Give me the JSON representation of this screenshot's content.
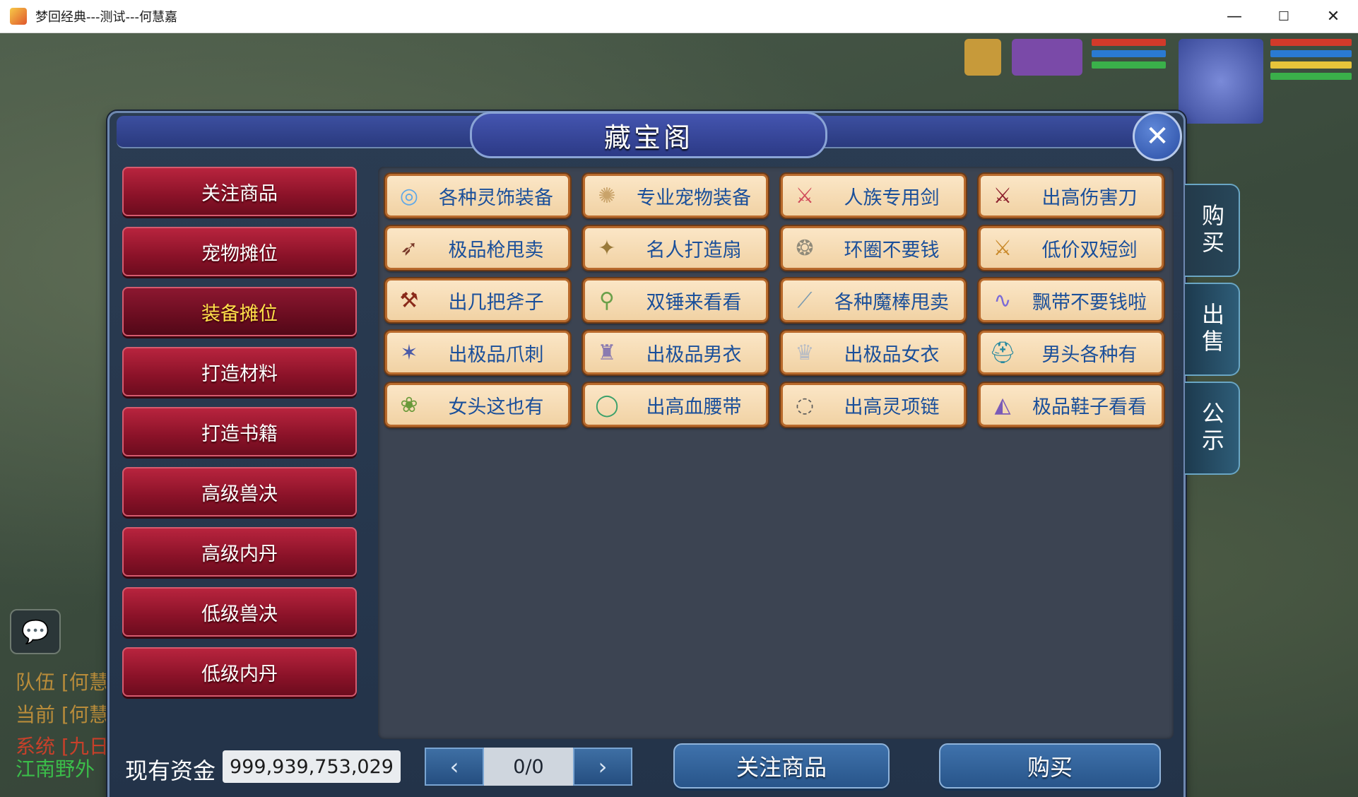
{
  "window": {
    "title": "梦回经典---测试---何慧嘉",
    "minimize_icon": "minimize-icon",
    "maximize_icon": "maximize-icon",
    "close_icon": "close-icon"
  },
  "game_hud": {
    "chat_lines": [
      "队伍 [何慧",
      "当前 [何慧",
      "系统 [九日"
    ],
    "location_text": "江南野外"
  },
  "dialog": {
    "title": "藏宝阁",
    "close_glyph": "✕"
  },
  "categories": [
    {
      "label": "关注商品",
      "active": false
    },
    {
      "label": "宠物摊位",
      "active": false
    },
    {
      "label": "装备摊位",
      "active": true
    },
    {
      "label": "打造材料",
      "active": false
    },
    {
      "label": "打造书籍",
      "active": false
    },
    {
      "label": "高级兽决",
      "active": false
    },
    {
      "label": "高级内丹",
      "active": false
    },
    {
      "label": "低级兽决",
      "active": false
    },
    {
      "label": "低级内丹",
      "active": false
    }
  ],
  "items": [
    {
      "label": "各种灵饰装备",
      "icon": "ring-icon",
      "glyph": "◎",
      "color": "#5fa8e8"
    },
    {
      "label": "专业宠物装备",
      "icon": "pet-collar-icon",
      "glyph": "✺",
      "color": "#c9a36a"
    },
    {
      "label": "人族专用剑",
      "icon": "sword-icon",
      "glyph": "⚔",
      "color": "#d04a5a"
    },
    {
      "label": "出高伤害刀",
      "icon": "blade-icon",
      "glyph": "⚔",
      "color": "#8a1c2a"
    },
    {
      "label": "极品枪甩卖",
      "icon": "spear-icon",
      "glyph": "➶",
      "color": "#7a3a2a"
    },
    {
      "label": "名人打造扇",
      "icon": "fan-icon",
      "glyph": "✦",
      "color": "#9a7a3a"
    },
    {
      "label": "环圈不要钱",
      "icon": "hoop-icon",
      "glyph": "❂",
      "color": "#8f8a7a"
    },
    {
      "label": "低价双短剑",
      "icon": "twin-dagger-icon",
      "glyph": "⚔",
      "color": "#c9892a"
    },
    {
      "label": "出几把斧子",
      "icon": "axe-icon",
      "glyph": "⚒",
      "color": "#8a2a1a"
    },
    {
      "label": "双锤来看看",
      "icon": "hammer-icon",
      "glyph": "⚲",
      "color": "#6aa04a"
    },
    {
      "label": "各种魔棒甩卖",
      "icon": "wand-icon",
      "glyph": "⟋",
      "color": "#7a9ab0"
    },
    {
      "label": "飘带不要钱啦",
      "icon": "ribbon-icon",
      "glyph": "∿",
      "color": "#7a6ad8"
    },
    {
      "label": "出极品爪刺",
      "icon": "claw-icon",
      "glyph": "✶",
      "color": "#4a5aa8"
    },
    {
      "label": "出极品男衣",
      "icon": "male-robe-icon",
      "glyph": "♜",
      "color": "#8a7ab0"
    },
    {
      "label": "出极品女衣",
      "icon": "female-robe-icon",
      "glyph": "♛",
      "color": "#b8bcc4"
    },
    {
      "label": "男头各种有",
      "icon": "male-helmet-icon",
      "glyph": "⛑",
      "color": "#2a8aa0"
    },
    {
      "label": "女头这也有",
      "icon": "female-headdress-icon",
      "glyph": "❀",
      "color": "#6a9a3a"
    },
    {
      "label": "出高血腰带",
      "icon": "belt-icon",
      "glyph": "◯",
      "color": "#3aa06a"
    },
    {
      "label": "出高灵项链",
      "icon": "necklace-icon",
      "glyph": "◌",
      "color": "#5a5a5a"
    },
    {
      "label": "极品鞋子看看",
      "icon": "boots-icon",
      "glyph": "◭",
      "color": "#7a5ab8"
    }
  ],
  "side_tabs": [
    {
      "label": "购买",
      "active": true
    },
    {
      "label": "出售",
      "active": false
    },
    {
      "label": "公示",
      "active": false
    }
  ],
  "footer": {
    "funds_label": "现有资金",
    "funds_value": "999,939,753,029",
    "prev_glyph": "‹",
    "next_glyph": "›",
    "page_value": "0/0",
    "watch_button": "关注商品",
    "buy_button": "购买"
  }
}
